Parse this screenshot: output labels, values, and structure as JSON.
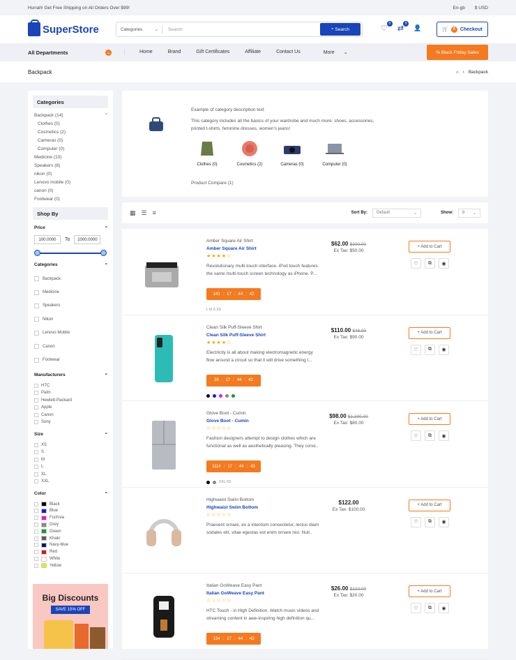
{
  "topbar": {
    "promo": "Hurrah! Get Free Shipping on All Orders Over $99!",
    "lang": "En-gb",
    "currency": "$ USD"
  },
  "header": {
    "logo": "SuperStore",
    "search_category": "Categories",
    "search_placeholder": "Search",
    "search_button": "Search",
    "wishlist_count": "0",
    "compare_count": "0",
    "cart_count": "0",
    "checkout": "Checkout"
  },
  "nav": {
    "departments": "All Departments",
    "links": [
      "Home",
      "Brand",
      "Gift Certificates",
      "Affiliate",
      "Contact Us",
      "More"
    ],
    "sale": "% Black Friday Sales"
  },
  "breadcrumb": {
    "title": "Backpack",
    "current": "Backpack"
  },
  "sidebar": {
    "categories_title": "Categories",
    "categories": [
      "Backpack (14)",
      "Clothes (0)",
      "Cosmetics (2)",
      "Cameras (0)",
      "Computer (0)",
      "Medicine (10)",
      "Speakers (8)",
      "nikon (0)",
      "Lenovo mobile (0)",
      "canon (0)",
      "Footwear (0)"
    ],
    "shopby_title": "Shop By",
    "price_label": "Price",
    "price_min": "100.0000",
    "price_to": "To",
    "price_max": "1000.0000",
    "cat_filter_label": "Categories",
    "cat_filters": [
      "Backpack",
      "Medicine",
      "Speakers",
      "Nikon",
      "Lenovo Mobile",
      "Canon",
      "Footwear"
    ],
    "manu_label": "Manufacturers",
    "manufacturers": [
      "HTC",
      "Palm",
      "Hewlett-Packard",
      "Apple",
      "Canon",
      "Sony"
    ],
    "size_label": "Size",
    "sizes": [
      "XS",
      "S",
      "M",
      "L",
      "XL",
      "XXL"
    ],
    "color_label": "Color",
    "colors": [
      {
        "name": "Black",
        "hex": "#000000"
      },
      {
        "name": "Blue",
        "hex": "#1a1ad6"
      },
      {
        "name": "Fuchsia",
        "hex": "#e81ad6"
      },
      {
        "name": "Grey",
        "hex": "#888888"
      },
      {
        "name": "Green",
        "hex": "#1a9a2a"
      },
      {
        "name": "Khaki",
        "hex": "#6b5a44"
      },
      {
        "name": "Navy-blue",
        "hex": "#141466"
      },
      {
        "name": "Red",
        "hex": "#d61a1a"
      },
      {
        "name": "White",
        "hex": "#ffffff"
      },
      {
        "name": "Yellow",
        "hex": "#e8e81a"
      }
    ],
    "promo_title": "Big Discounts",
    "promo_badge": "SAVE 15% OFF"
  },
  "category": {
    "desc_title": "Example of category description text",
    "desc": "This category includes all the basics of your wardrobe and much more: shoes, accessories, printed t-shirts, feminine dresses, women's jeans!",
    "subcats": [
      "Clothes (0)",
      "Cosmetics (2)",
      "Cameras (0)",
      "Computer (0)"
    ],
    "compare": "Product Compare (1)"
  },
  "toolbar": {
    "sort_label": "Sort By:",
    "sort_value": "Default",
    "show_label": "Show:",
    "show_value": "9"
  },
  "products": [
    {
      "subtitle": "Amber Square Air Shirt",
      "name": "Amber Square Air Shirt",
      "stars": "★★★★☆",
      "desc": "Revolutionary multi-touch interface. iPod touch features the same multi-touch screen technology as iPhone. P...",
      "countdown": [
        "143",
        "17",
        "44",
        "42"
      ],
      "extras": "L  M  S  XS",
      "price": "$62.00",
      "old": "$300.00",
      "tax": "Ex Tax: $50.00"
    },
    {
      "subtitle": "Clean Silk Puff-Sleeve Shirt",
      "name": "Clean Silk Puff-Sleeve Shirt",
      "stars": "★★★★☆",
      "desc": "Electricity is all about making electromagnetic energy flow around a circuit so that it will drive something l...",
      "countdown": [
        "36",
        "17",
        "44",
        "42"
      ],
      "extras": "",
      "price": "$110.00",
      "old": "$48.00",
      "tax": "Ex Tax: $90.00"
    },
    {
      "subtitle": "Glove Boot - Cumin",
      "name": "Glove Boot - Cumin",
      "stars": "☆☆☆☆☆",
      "desc": "Fashion designers attempt to design clothes which are functional as well as aesthetically pleasing. They consi..",
      "countdown": [
        "1114",
        "17",
        "44",
        "43"
      ],
      "extras": "XXL  XS",
      "price": "$98.00",
      "old": "$1,200.00",
      "tax": "Ex Tax: $80.00"
    },
    {
      "subtitle": "Highwaist Swim Bottom",
      "name": "Highwaist Swim Bottom",
      "stars": "☆☆☆☆☆",
      "desc": "Praesent ornare, ex a interdum consectetur, lectus diam sodales elit, vitae egestas est enim ornare nisl. Null..",
      "countdown": [],
      "extras": "",
      "price": "$122.00",
      "old": "",
      "tax": "Ex Tax: $100.00"
    },
    {
      "subtitle": "Italian GoWeave Easy Pant",
      "name": "Italian GoWeave Easy Pant",
      "stars": "☆☆☆☆☆",
      "desc": "HTC Touch - in High Definition. Watch music videos and streaming content in awe-inspiring high definition qu...",
      "countdown": [
        "134",
        "17",
        "44",
        "43"
      ],
      "extras": "",
      "price": "$26.00",
      "old": "$122.00",
      "tax": "Ex Tax: $20.00"
    }
  ],
  "add_to_cart": "+ Add to Cart"
}
